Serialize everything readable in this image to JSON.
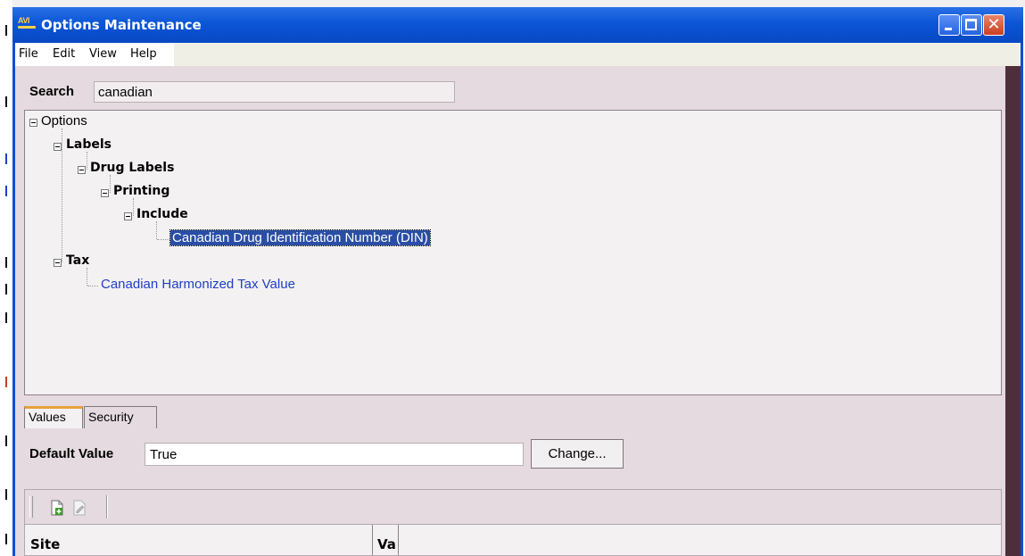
{
  "window": {
    "title": "Options Maintenance",
    "app_icon_text": "AVI"
  },
  "menu": {
    "items": [
      "File",
      "Edit",
      "View",
      "Help"
    ]
  },
  "search": {
    "label": "Search",
    "value": "canadian"
  },
  "tree": {
    "root": "Options",
    "labels": "Labels",
    "drug_labels": "Drug Labels",
    "printing": "Printing",
    "include": "Include",
    "din": "Canadian Drug Identification Number (DIN)",
    "tax": "Tax",
    "harmonized": "Canadian Harmonized Tax Value"
  },
  "tabs": [
    "Values",
    "Security"
  ],
  "default_value": {
    "label": "Default Value",
    "value": "True",
    "button": "Change..."
  },
  "grid": {
    "columns": [
      "Site",
      "Va"
    ]
  },
  "colors": {
    "title_bar": "#0b56d6",
    "selection": "#2a4ea5",
    "link": "#1f3ec8",
    "panel": "#e4dadf"
  }
}
